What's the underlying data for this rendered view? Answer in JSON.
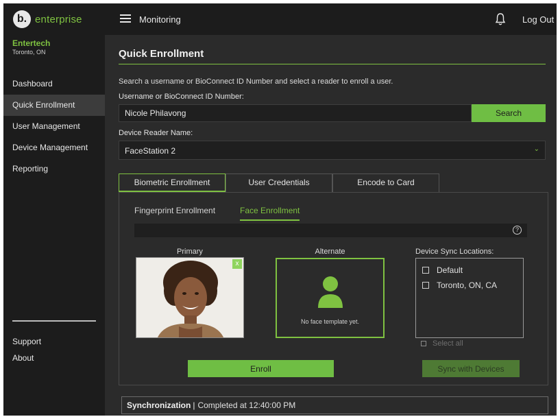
{
  "app": {
    "logo_letter": "b.",
    "logo_text": "enterprise",
    "header_title": "Monitoring",
    "logout_label": "Log Out",
    "accent_color": "#7fc241"
  },
  "sidebar": {
    "org_name": "Entertech",
    "org_location": "Toronto, ON",
    "items": [
      {
        "label": "Dashboard"
      },
      {
        "label": "Quick Enrollment",
        "active": true
      },
      {
        "label": "User Management"
      },
      {
        "label": "Device Management"
      },
      {
        "label": "Reporting"
      }
    ],
    "footer_items": [
      {
        "label": "Support"
      },
      {
        "label": "About"
      }
    ]
  },
  "main": {
    "title": "Quick Enrollment",
    "instructions": "Search a username or BioConnect ID Number and select a reader to enroll a user.",
    "username_label": "Username or BioConnect ID Number:",
    "username_value": "Nicole Philavong",
    "search_label": "Search",
    "reader_label": "Device Reader Name:",
    "reader_value": "FaceStation 2",
    "tabs": [
      {
        "label": "Biometric Enrollment",
        "active": true
      },
      {
        "label": "User Credentials"
      },
      {
        "label": "Encode to Card"
      }
    ],
    "subtabs": [
      {
        "label": "Fingerprint Enrollment"
      },
      {
        "label": "Face Enrollment",
        "active": true
      }
    ],
    "help_glyph": "?",
    "primary_label": "Primary",
    "primary_close": "x",
    "alternate_label": "Alternate",
    "alternate_message": "No face template yet.",
    "sync_locations_label": "Device Sync Locations:",
    "sync_locations": [
      {
        "label": "Default"
      },
      {
        "label": "Toronto, ON, CA"
      }
    ],
    "select_all_label": "Select all",
    "enroll_label": "Enroll",
    "sync_devices_label": "Sync with Devices",
    "sync_status_label": "Synchronization",
    "sync_status_sep": "|",
    "sync_status_value": "Completed at 12:40:00 PM"
  }
}
